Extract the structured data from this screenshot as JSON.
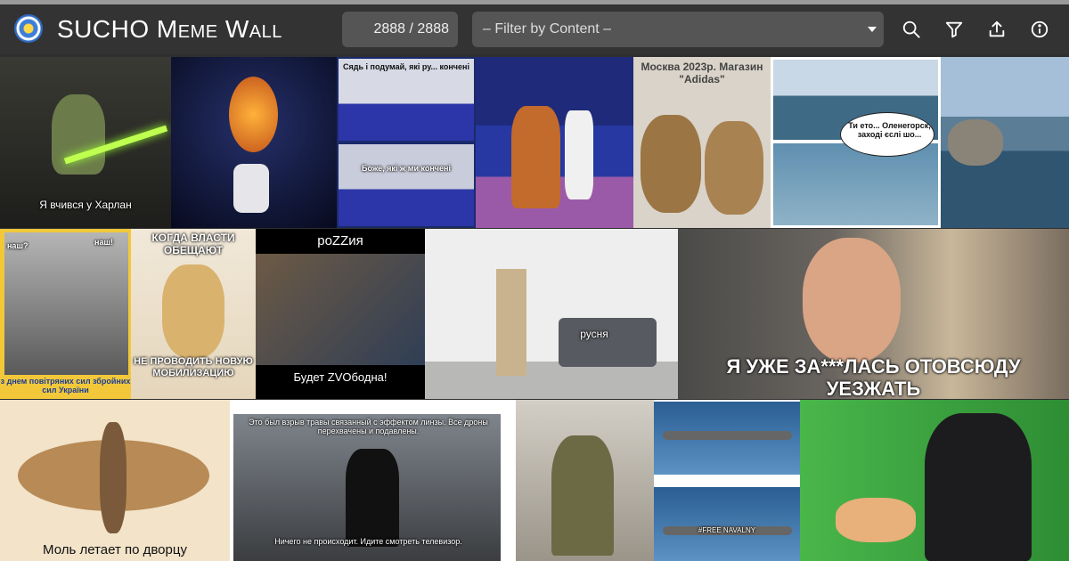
{
  "header": {
    "title_first": "SUCHO",
    "title_rest": "Meme Wall",
    "counter": "2888 / 2888",
    "filter_placeholder": "– Filter by Content –",
    "logo_icon": "sucho-logo-icon",
    "toolbar_icons": [
      "search-icon",
      "filter-icon",
      "upload-icon",
      "info-icon"
    ]
  },
  "memes": [
    {
      "id": "yoda",
      "caption": "Я вчився у Харлан"
    },
    {
      "id": "chicken-torch",
      "caption": ""
    },
    {
      "id": "fencing-think",
      "caption_top": "Сядь і подумай, які ру... кончені",
      "caption_bottom": "Боже, які ж ми кончені"
    },
    {
      "id": "fox-fencer",
      "caption": ""
    },
    {
      "id": "moscow-adidas",
      "caption": "Москва 2023р. Магазин \"Adidas\""
    },
    {
      "id": "ships",
      "caption": "Ти ето... Оленегорск, заході єслі шо..."
    },
    {
      "id": "cat-sea",
      "caption": ""
    },
    {
      "id": "kids-airforce",
      "caption_left": "наш?",
      "caption_right": "наш!",
      "caption": "з днем повітряних сил збройних сил України"
    },
    {
      "id": "borat-noodles",
      "caption_top": "КОГДА ВЛАСТИ ОБЕЩАЮТ",
      "caption": "НЕ ПРОВОДИТЬ НОВУЮ МОБИЛИЗАЦИЮ"
    },
    {
      "id": "pozzia",
      "caption_top": "роZZия",
      "caption": "Будет ZVOбодна!"
    },
    {
      "id": "hospital",
      "caption": "русня"
    },
    {
      "id": "crying-woman",
      "caption": "Я УЖЕ ЗА***ЛАСЬ ОТОВСЮДУ УЕЗЖАТЬ"
    },
    {
      "id": "moth-tsar",
      "caption": "Моль летает по дворцу"
    },
    {
      "id": "men-in-black",
      "caption_top": "Это был взрыв травы связанный с эффектом линзы. Все дроны перехвачены и подавлены.",
      "caption": "Ничего не происходит. Идите смотреть телевизор."
    },
    {
      "id": "medvedchuk",
      "caption": ""
    },
    {
      "id": "bombers",
      "caption_bottom": "#FREE NAVALNY"
    },
    {
      "id": "navalny",
      "caption": ""
    }
  ]
}
